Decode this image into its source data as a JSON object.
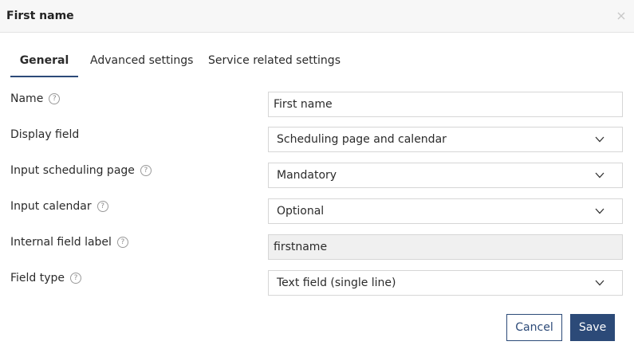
{
  "dialog": {
    "title": "First name",
    "close_glyph": "×"
  },
  "tabs": [
    {
      "label": "General",
      "active": true
    },
    {
      "label": "Advanced settings",
      "active": false
    },
    {
      "label": "Service related settings",
      "active": false
    }
  ],
  "form": {
    "help_glyph": "?",
    "name": {
      "label": "Name",
      "value": "First name"
    },
    "display_field": {
      "label": "Display field",
      "value": "Scheduling page and calendar"
    },
    "input_scheduling_page": {
      "label": "Input scheduling page",
      "value": "Mandatory"
    },
    "input_calendar": {
      "label": "Input calendar",
      "value": "Optional"
    },
    "internal_field_label": {
      "label": "Internal field label",
      "value": "firstname"
    },
    "field_type": {
      "label": "Field type",
      "value": "Text field (single line)"
    }
  },
  "actions": {
    "cancel_label": "Cancel",
    "save_label": "Save"
  },
  "colors": {
    "accent": "#2c4a78",
    "header_bg": "#f7f7f7",
    "readonly_bg": "#f0f0f0"
  },
  "icons": {
    "close": "close-icon",
    "help": "help-icon",
    "dropdown": "chevron-down-icon"
  }
}
